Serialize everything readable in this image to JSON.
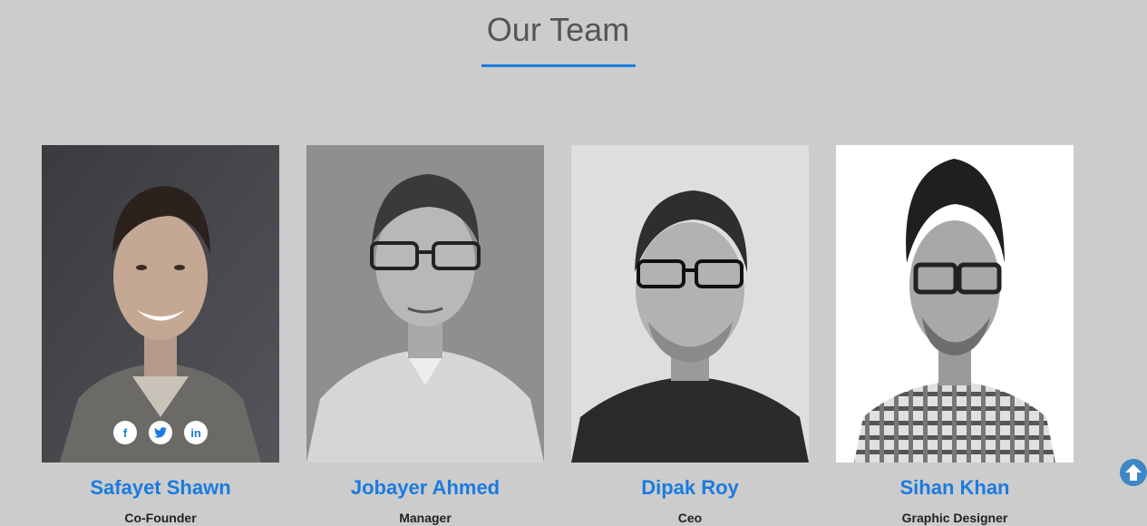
{
  "section": {
    "title": "Our Team"
  },
  "colors": {
    "accent": "#1a7be0",
    "background": "#cccccc",
    "scroll_button": "#3e86c6"
  },
  "members": [
    {
      "name": "Safayet Shawn",
      "role": "Co-Founder",
      "social": [
        {
          "icon": "facebook-icon",
          "glyph": "f"
        },
        {
          "icon": "twitter-icon",
          "glyph": "🐦"
        },
        {
          "icon": "linkedin-icon",
          "glyph": "in"
        }
      ]
    },
    {
      "name": "Jobayer Ahmed",
      "role": "Manager"
    },
    {
      "name": "Dipak Roy",
      "role": "Ceo"
    },
    {
      "name": "Sihan Khan",
      "role": "Graphic Designer"
    }
  ],
  "scroll_top": {
    "icon": "arrow-up-circle-icon"
  }
}
